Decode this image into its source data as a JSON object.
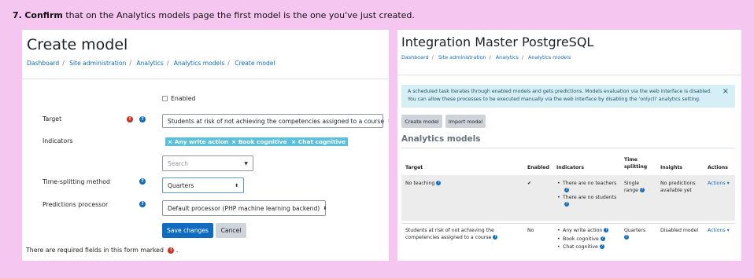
{
  "instruction": {
    "step": "7.",
    "bold": "Confirm",
    "text": "that on the Analytics models page the first model is the one you've just created."
  },
  "left_panel": {
    "title": "Create model",
    "breadcrumbs": [
      "Dashboard",
      "Site administration",
      "Analytics",
      "Analytics models",
      "Create model"
    ],
    "enabled_label": "Enabled",
    "enabled_checked": false,
    "target_label": "Target",
    "target_value": "Students at risk of not achieving the competencies assigned to a course",
    "indicators_label": "Indicators",
    "indicator_tags": [
      "× Any write action",
      "× Book cognitive",
      "× Chat cognitive"
    ],
    "search_placeholder": "Search",
    "time_splitting_label": "Time-splitting method",
    "time_splitting_value": "Quarters",
    "predictions_label": "Predictions processor",
    "predictions_value": "Default processor (PHP machine learning backend)",
    "save_button": "Save changes",
    "cancel_button": "Cancel",
    "required_note": "There are required fields in this form marked",
    "required_note_end": ".",
    "icons": {
      "required": "exclamation-circle-icon",
      "help": "question-circle-icon"
    },
    "colors": {
      "primary": "#0f6cbf",
      "danger": "#ca3120",
      "tag": "#5bc0de"
    }
  },
  "right_panel": {
    "title": "Integration Master PostgreSQL",
    "breadcrumbs": [
      "Dashboard",
      "Site administration",
      "Analytics",
      "Analytics models"
    ],
    "alert_text": "A scheduled task iterates through enabled models and gets predictions. Models evaluation via the web interface is disabled. You can allow these processes to be executed manually via the web interface by disabling the 'onlycli' analytics setting.",
    "alert_close": "×",
    "create_model_button": "Create model",
    "import_model_button": "Import model",
    "section_title": "Analytics models",
    "table": {
      "headers": {
        "target": "Target",
        "enabled": "Enabled",
        "indicators": "Indicators",
        "time_splitting_1": "Time",
        "time_splitting_2": "splitting",
        "insights": "Insights",
        "actions": "Actions"
      },
      "rows": [
        {
          "target": "No teaching",
          "enabled": "✔",
          "indicators": [
            "There are no teachers",
            "There are no students"
          ],
          "time_splitting_1": "Single",
          "time_splitting_2": "range",
          "insights_1": "No predictions",
          "insights_2": "available yet",
          "actions": "Actions ▾"
        },
        {
          "target_1": "Students at risk of not achieving the",
          "target_2": "competencies assigned to a course",
          "enabled": "No",
          "indicators": [
            "Any write action",
            "Book cognitive",
            "Chat cognitive"
          ],
          "time_splitting_1": "Quarters",
          "insights_1": "Disabled model",
          "actions": "Actions ▾"
        }
      ]
    },
    "colors": {
      "alert_bg": "#d6eef6",
      "row_bg": "#ececec"
    }
  }
}
